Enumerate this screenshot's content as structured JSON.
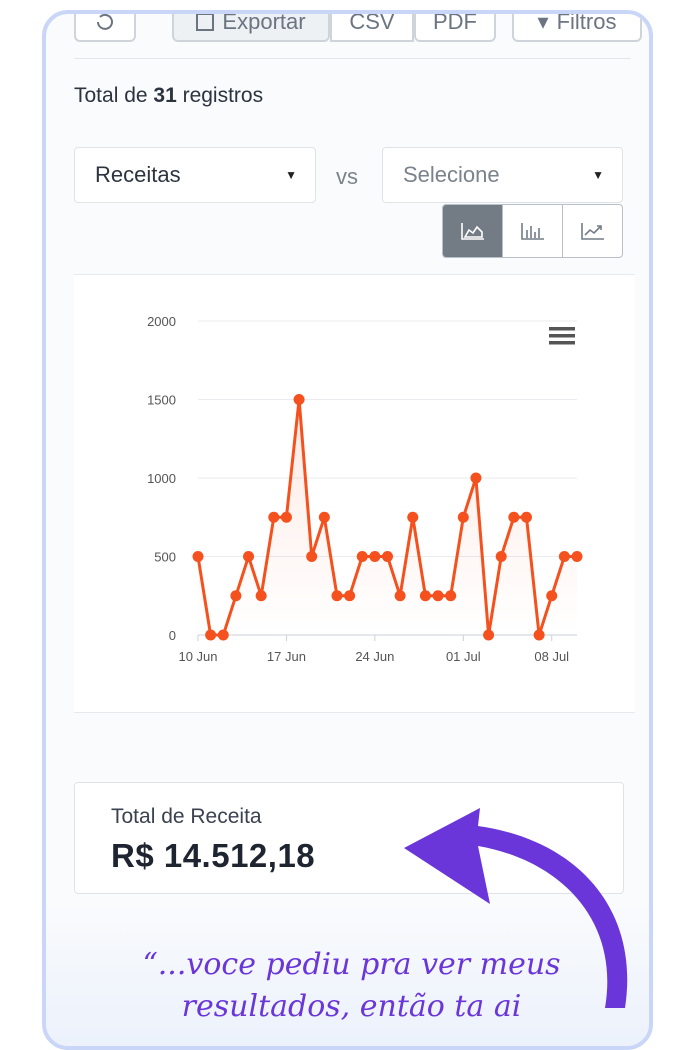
{
  "toolbar": {
    "export_label": "Exportar",
    "csv_label": "CSV",
    "pdf_label": "PDF",
    "filters_label": "Filtros"
  },
  "summary": {
    "prefix": "Total de ",
    "count": "31",
    "suffix": " registros"
  },
  "compare": {
    "primary_value": "Receitas",
    "vs_label": "vs",
    "secondary_placeholder": "Selecione"
  },
  "chart_type_buttons": [
    "area-chart-icon",
    "bar-chart-icon",
    "line-chart-icon"
  ],
  "chart_data": {
    "type": "line",
    "x": [
      "10 Jun",
      "11 Jun",
      "12 Jun",
      "13 Jun",
      "14 Jun",
      "15 Jun",
      "16 Jun",
      "17 Jun",
      "18 Jun",
      "19 Jun",
      "20 Jun",
      "21 Jun",
      "22 Jun",
      "23 Jun",
      "24 Jun",
      "25 Jun",
      "26 Jun",
      "27 Jun",
      "28 Jun",
      "29 Jun",
      "30 Jun",
      "01 Jul",
      "02 Jul",
      "03 Jul",
      "04 Jul",
      "05 Jul",
      "06 Jul",
      "07 Jul",
      "08 Jul",
      "09 Jul",
      "10 Jul"
    ],
    "series": [
      {
        "values": [
          500,
          0,
          0,
          250,
          500,
          250,
          750,
          750,
          1500,
          500,
          750,
          250,
          250,
          500,
          500,
          500,
          250,
          750,
          250,
          250,
          250,
          750,
          1000,
          0,
          500,
          750,
          750,
          0,
          250,
          500,
          500
        ]
      }
    ],
    "xticks": [
      "10 Jun",
      "17 Jun",
      "24 Jun",
      "01 Jul",
      "08 Jul"
    ],
    "yticks": [
      0,
      500,
      1000,
      1500,
      2000
    ],
    "ylim": [
      0,
      2000
    ],
    "grid": true,
    "line_color": "#f4511e",
    "menu_icon": "hamburger-menu-icon"
  },
  "revenue": {
    "label": "Total de Receita",
    "value": "R$ 14.512,18"
  },
  "quote": {
    "line1": "“...voce pediu pra ver meus",
    "line2": "resultados, então ta ai"
  },
  "colors": {
    "accent_purple": "#6a36d9",
    "frame_border": "#c9d6f7"
  }
}
